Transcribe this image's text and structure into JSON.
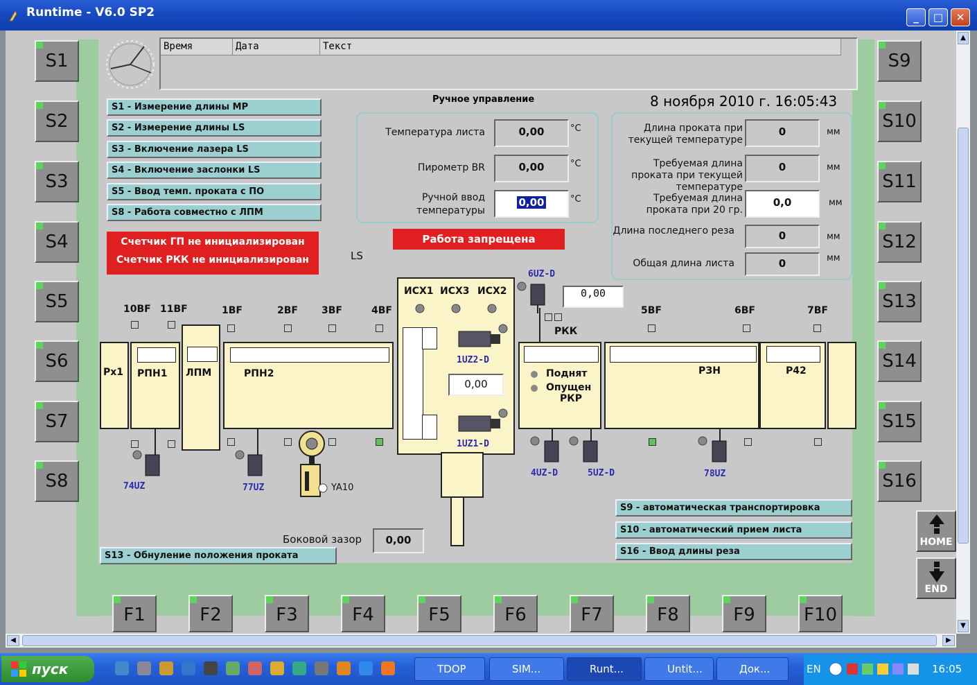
{
  "window": {
    "title": "Runtime - V6.0 SP2",
    "minimize": "_",
    "maximize": "□",
    "close": "✕"
  },
  "alarm": {
    "headers": [
      "Время",
      "Дата",
      "Текст"
    ]
  },
  "heading": "Ручное управление",
  "datetime": "8 ноября 2010 г. 16:05:43",
  "left_buttons": [
    "S1",
    "S2",
    "S3",
    "S4",
    "S5",
    "S6",
    "S7",
    "S8"
  ],
  "right_buttons": [
    "S9",
    "S10",
    "S11",
    "S12",
    "S13",
    "S14",
    "S15",
    "S16"
  ],
  "f_buttons": [
    "F1",
    "F2",
    "F3",
    "F4",
    "F5",
    "F6",
    "F7",
    "F8",
    "F9",
    "F10"
  ],
  "s_items": [
    "S1 - Измерение длины МР",
    "S2 - Измерение длины LS",
    "S3 - Включение лазера LS",
    "S4 - Включение заслонки LS",
    "S5 - Ввод темп. проката с ПО",
    "S8 - Работа совместно с ЛПМ"
  ],
  "alarm_red": [
    "Счетчик ГП не инициализирован",
    "Счетчик РКК не инициализирован"
  ],
  "work_forbidden": "Работа запрещена",
  "ls_label": "LS",
  "temp_panel": {
    "rows": [
      {
        "label": "Температура листа",
        "value": "0,00",
        "unit": "°C"
      },
      {
        "label": "Пирометр BR",
        "value": "0,00",
        "unit": "°C"
      },
      {
        "label": "Ручной ввод температуры",
        "value": "0,00",
        "unit": "°C"
      }
    ]
  },
  "length_panel": {
    "rows": [
      {
        "label": "Длина проката при текущей температуре",
        "value": "0",
        "unit": "мм"
      },
      {
        "label": "Требуемая длина проката при текущей температуре",
        "value": "0",
        "unit": "мм"
      },
      {
        "label": "Требуемая длина проката при 20 гр.",
        "value": "0,0",
        "unit": "мм"
      },
      {
        "label": "Длина последнего реза",
        "value": "0",
        "unit": "мм"
      },
      {
        "label": "Общая длина листа",
        "value": "0",
        "unit": "мм"
      }
    ]
  },
  "sensors": [
    "10BF",
    "11BF",
    "1BF",
    "2BF",
    "3BF",
    "4BF",
    "5BF",
    "6BF",
    "7BF"
  ],
  "blocks": {
    "px1": "Px1",
    "rpn1": "РПН1",
    "lpm": "ЛПМ",
    "rpn2": "РПН2",
    "rzn": "РЗН",
    "r42": "Р42",
    "rkk": "РКК"
  },
  "isx": [
    "ИСХ1",
    "ИСХ3",
    "ИСХ2"
  ],
  "isx_value": "0,00",
  "uz": {
    "uz6": "6UZ-D",
    "uz6_value": "0,00",
    "uz1_2": "1UZ2-D",
    "uz1_1": "1UZ1-D",
    "uz4": "4UZ-D",
    "uz5": "5UZ-D",
    "uz78": "78UZ",
    "uz74": "74UZ",
    "uz77": "77UZ",
    "ya10": "YA10"
  },
  "rkp": {
    "up": "Поднят",
    "down": "Опущен",
    "name": "РКР"
  },
  "side_gap": {
    "label": "Боковой зазор",
    "value": "0,00"
  },
  "s13_item": "S13 - Обнуление положения проката",
  "r_items": [
    "S9 -  автоматическая транспортировка",
    "S10 - автоматический прием листа",
    "S16 - Ввод длины реза"
  ],
  "nav": {
    "home": "HOME",
    "end": "END"
  },
  "taskbar": {
    "start": "пуск",
    "tasks": [
      "TDOP",
      "SIM...",
      "Runt...",
      "Untit...",
      "Док..."
    ],
    "lang": "EN",
    "clock": "16:05"
  },
  "colors": {
    "panel_green": "#9ccc9f",
    "item_cyan": "#9ccfd0",
    "alarm_red": "#e02020",
    "block_yellow": "#fbf4c8",
    "indicator_green": "#5fd35f"
  }
}
